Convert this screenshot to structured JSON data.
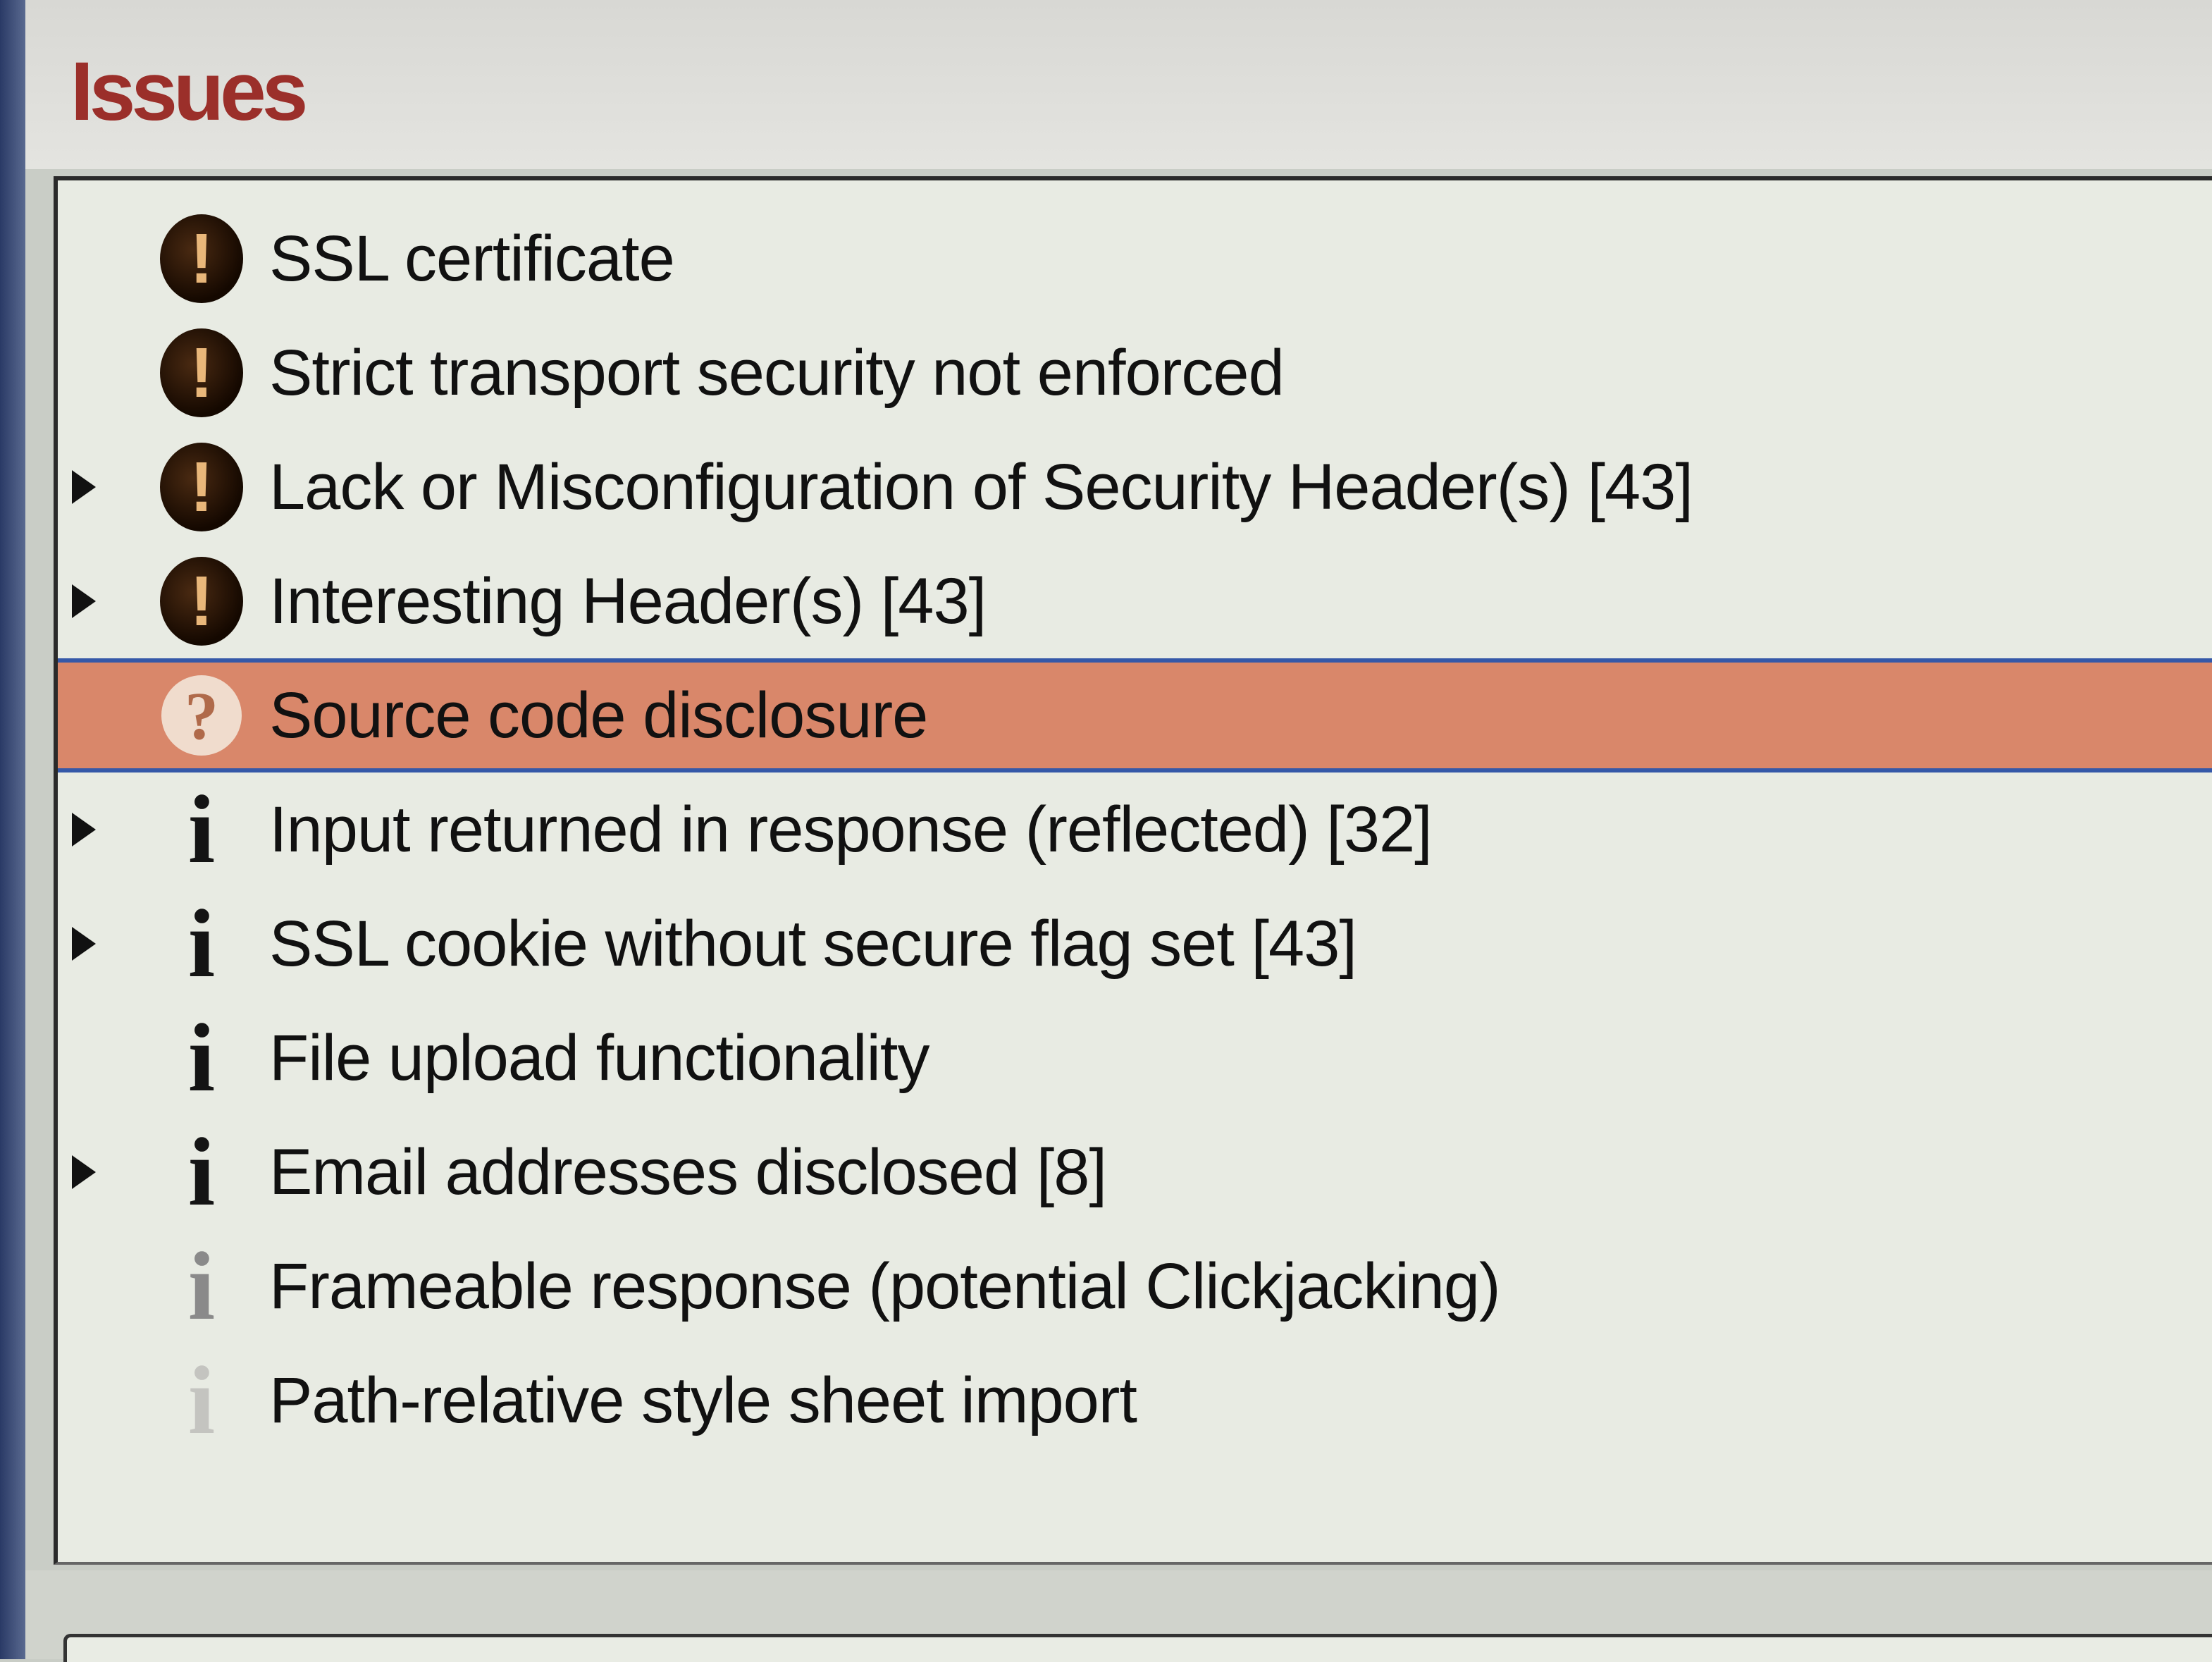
{
  "panel": {
    "title": "Issues"
  },
  "issues": [
    {
      "label": "SSL certificate",
      "severity": "high",
      "expandable": false,
      "selected": false
    },
    {
      "label": "Strict transport security not enforced",
      "severity": "high",
      "expandable": false,
      "selected": false
    },
    {
      "label": "Lack or Misconfiguration of Security Header(s) [43]",
      "severity": "high",
      "expandable": true,
      "selected": false
    },
    {
      "label": "Interesting Header(s) [43]",
      "severity": "high",
      "expandable": true,
      "selected": false
    },
    {
      "label": "Source code disclosure",
      "severity": "unknown",
      "expandable": false,
      "selected": true
    },
    {
      "label": "Input returned in response (reflected) [32]",
      "severity": "info",
      "expandable": true,
      "selected": false
    },
    {
      "label": "SSL cookie without secure flag set [43]",
      "severity": "info",
      "expandable": true,
      "selected": false
    },
    {
      "label": "File upload functionality",
      "severity": "info",
      "expandable": false,
      "selected": false
    },
    {
      "label": "Email addresses disclosed [8]",
      "severity": "info",
      "expandable": true,
      "selected": false
    },
    {
      "label": "Frameable response (potential Clickjacking)",
      "severity": "info-low",
      "expandable": false,
      "selected": false
    },
    {
      "label": "Path-relative style sheet import",
      "severity": "info-lowest",
      "expandable": false,
      "selected": false
    }
  ],
  "icons": {
    "high": "exclamation-icon",
    "unknown": "question-icon",
    "info": "info-icon"
  },
  "colors": {
    "title": "#9b2f2a",
    "selection": "#d9876a",
    "selection_border": "#3558a8"
  }
}
